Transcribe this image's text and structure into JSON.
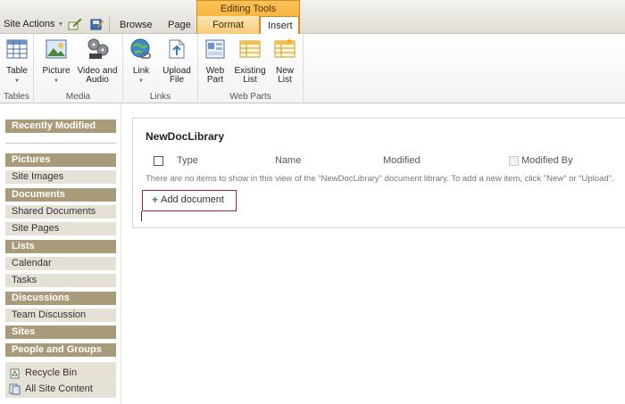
{
  "topbar": {
    "site_actions": "Site Actions",
    "tabs": {
      "browse": "Browse",
      "page": "Page"
    },
    "contextual_group": "Editing Tools",
    "contextual_tabs": {
      "format_text": "Format Text",
      "insert": "Insert"
    }
  },
  "ribbon": {
    "groups": {
      "tables": {
        "label": "Tables",
        "table": "Table"
      },
      "media": {
        "label": "Media",
        "picture": "Picture",
        "video_audio": "Video and\nAudio"
      },
      "links": {
        "label": "Links",
        "link": "Link",
        "upload_file": "Upload\nFile"
      },
      "web_parts": {
        "label": "Web Parts",
        "web_part": "Web\nPart",
        "existing_list": "Existing\nList",
        "new_list": "New\nList"
      }
    }
  },
  "leftnav": {
    "recently_modified": "Recently Modified",
    "sections": {
      "pictures": "Pictures",
      "site_images": "Site Images",
      "documents": "Documents",
      "shared_documents": "Shared Documents",
      "site_pages": "Site Pages",
      "lists": "Lists",
      "calendar": "Calendar",
      "tasks": "Tasks",
      "discussions": "Discussions",
      "team_discussion": "Team Discussion",
      "sites": "Sites",
      "people_groups": "People and Groups"
    },
    "recycle_bin": "Recycle Bin",
    "all_site_content": "All Site Content"
  },
  "main": {
    "title": "NewDocLibrary",
    "columns": {
      "type": "Type",
      "name": "Name",
      "modified": "Modified",
      "modified_by": "Modified By"
    },
    "empty_message": "There are no items to show in this view of the \"NewDocLibrary\" document library. To add a new item, click \"New\" or \"Upload\".",
    "add_document": "Add document"
  },
  "colors": {
    "accent_orange": "#f5a623",
    "nav_header": "#a89b79",
    "nav_item": "#e6e1d6",
    "highlight_red": "#a3242b"
  }
}
